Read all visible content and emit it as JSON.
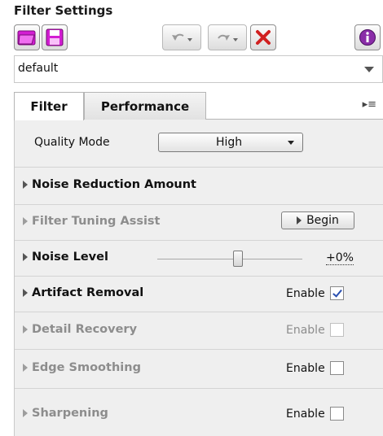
{
  "header": {
    "title": "Filter Settings"
  },
  "toolbar": {
    "open_icon": "folder-open-icon",
    "save_icon": "floppy-save-icon",
    "undo_icon": "undo-icon",
    "redo_icon": "redo-icon",
    "delete_icon": "red-x-icon",
    "info_icon": "info-icon"
  },
  "preset": {
    "value": "default"
  },
  "tabs": [
    {
      "label": "Filter",
      "active": true
    },
    {
      "label": "Performance",
      "active": false
    }
  ],
  "tab_menu_glyph": "▸≡",
  "filter": {
    "quality_mode": {
      "label": "Quality Mode",
      "value": "High"
    },
    "noise_reduction": {
      "label": "Noise Reduction Amount"
    },
    "tuning_assist": {
      "label": "Filter Tuning Assist",
      "button": "Begin",
      "disabled": true
    },
    "noise_level": {
      "label": "Noise Level",
      "value": "+0%",
      "slider_fraction": 0.5
    },
    "artifact_removal": {
      "label": "Artifact Removal",
      "enable_label": "Enable",
      "checked": true,
      "disabled": false
    },
    "detail_recovery": {
      "label": "Detail Recovery",
      "enable_label": "Enable",
      "checked": false,
      "disabled": true
    },
    "edge_smoothing": {
      "label": "Edge Smoothing",
      "enable_label": "Enable",
      "checked": false,
      "disabled": true
    },
    "sharpening": {
      "label": "Sharpening",
      "enable_label": "Enable",
      "checked": false,
      "disabled": true
    }
  },
  "colors": {
    "accent_purple": "#d21cd2",
    "delete_red": "#d12020",
    "info_purple": "#8a2da8",
    "panel_bg": "#efefef"
  }
}
